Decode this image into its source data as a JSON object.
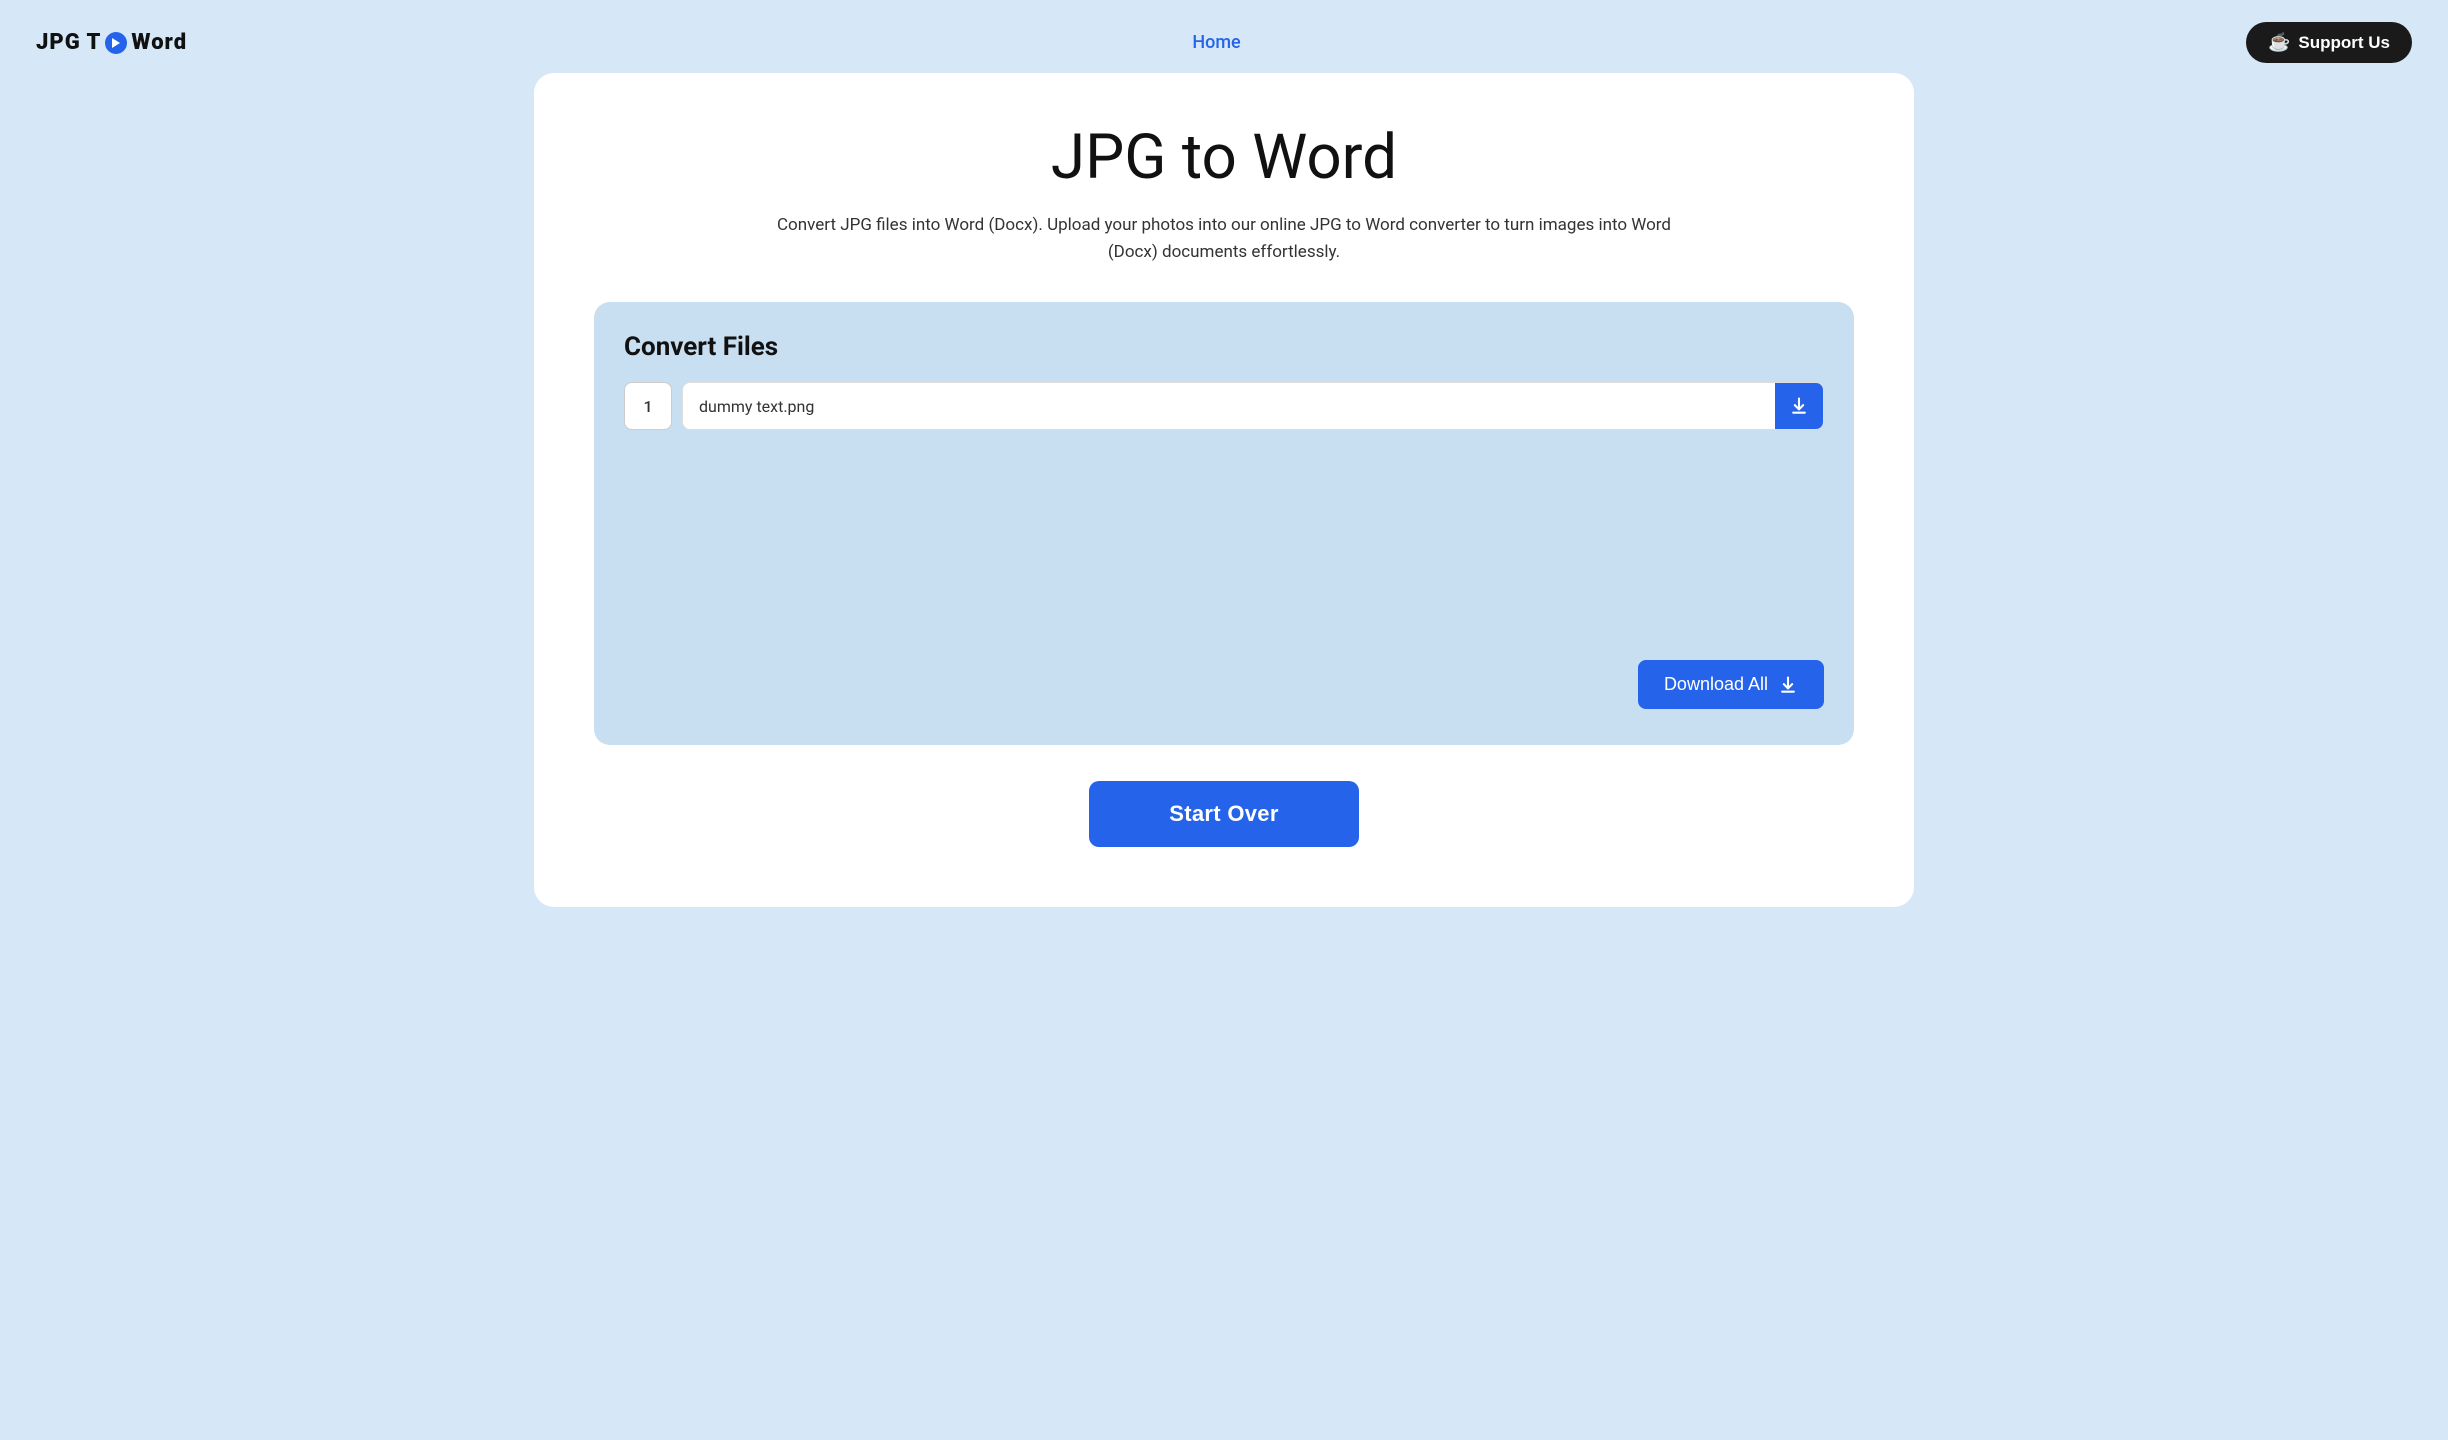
{
  "navbar": {
    "logo": {
      "part1": "JPG T",
      "part2": "Word",
      "arrow_symbol": "▶"
    },
    "nav": {
      "home_label": "Home"
    },
    "support_button": {
      "label": "Support Us",
      "icon": "☕"
    }
  },
  "main": {
    "title": "JPG to Word",
    "subtitle": "Convert JPG files into Word (Docx). Upload your photos into our online JPG to Word converter to turn images into Word (Docx) documents effortlessly.",
    "convert_section": {
      "title": "Convert Files",
      "file_row": {
        "number": "1",
        "filename": "dummy text.png"
      },
      "download_all_label": "Download All",
      "start_over_label": "Start Over"
    }
  }
}
